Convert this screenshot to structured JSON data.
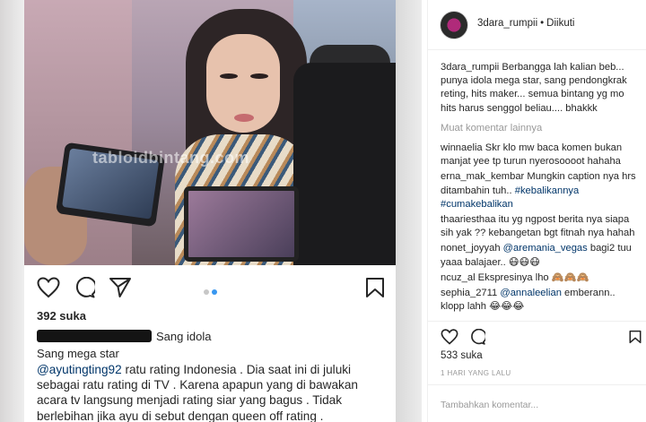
{
  "post": {
    "watermark": "tabloidbintang.com",
    "likes": "392 suka",
    "caption_user_tail": "Sang idola",
    "caption_line2": "Sang mega star",
    "caption_mention": "@ayutingting92",
    "caption_text": " ratu rating Indonesia . Dia saat ini di juluki sebagai ratu rating di TV . Karena apapun yang di bawakan acara tv langsung menjadi rating siar yang bagus . Tidak berlebihan jika ayu di sebut dengan queen off rating ."
  },
  "right": {
    "username": "3dara_rumpii",
    "separator": "•",
    "follow_status": "Diikuti",
    "comments_top": [
      {
        "user": "3dara_rumpii",
        "text": " Berbangga lah kalian beb... punya idola mega star, sang pendongkrak reting, hits maker... semua bintang yg mo hits harus senggol beliau.... bhakkk"
      }
    ],
    "more_comments": "Muat komentar lainnya",
    "comments": [
      {
        "user": "winnaelia",
        "text": " Skr klo mw baca komen bukan manjat yee tp turun nyerosoooot hahaha",
        "mention": ""
      },
      {
        "user": "erna_mak_kembar",
        "text": " Mungkin caption nya hrs ditambahin tuh..",
        "mention": " #kebalikannya #cumakebalikan"
      },
      {
        "user": "thaariesthaa",
        "text": " itu yg ngpost berita nya siapa sih yak ?? kebangetan bgt fitnah nya hahah",
        "mention": ""
      },
      {
        "user": "nonet_joyyah",
        "mention_first": " @aremania_vegas",
        "text": " bagi2 tuu yaaa balajaer.. 😷😷😷"
      },
      {
        "user": "ncuz_al",
        "text": " Ekspresinya lho 🙈🙈🙈",
        "mention": ""
      },
      {
        "user": "sephia_2711",
        "mention_first": " @annaleelian",
        "text": " emberann.. klopp lahh 😂😂😂"
      }
    ],
    "likes": "533 suka",
    "time": "1 HARI YANG LALU",
    "add_comment_placeholder": "Tambahkan komentar..."
  },
  "colors": {
    "link": "#003569",
    "muted": "#999999",
    "dot_active": "#3897f0",
    "dot_inactive": "#c7c7c7"
  },
  "icons": [
    "heart-icon",
    "comment-icon",
    "share-icon",
    "bookmark-icon"
  ]
}
